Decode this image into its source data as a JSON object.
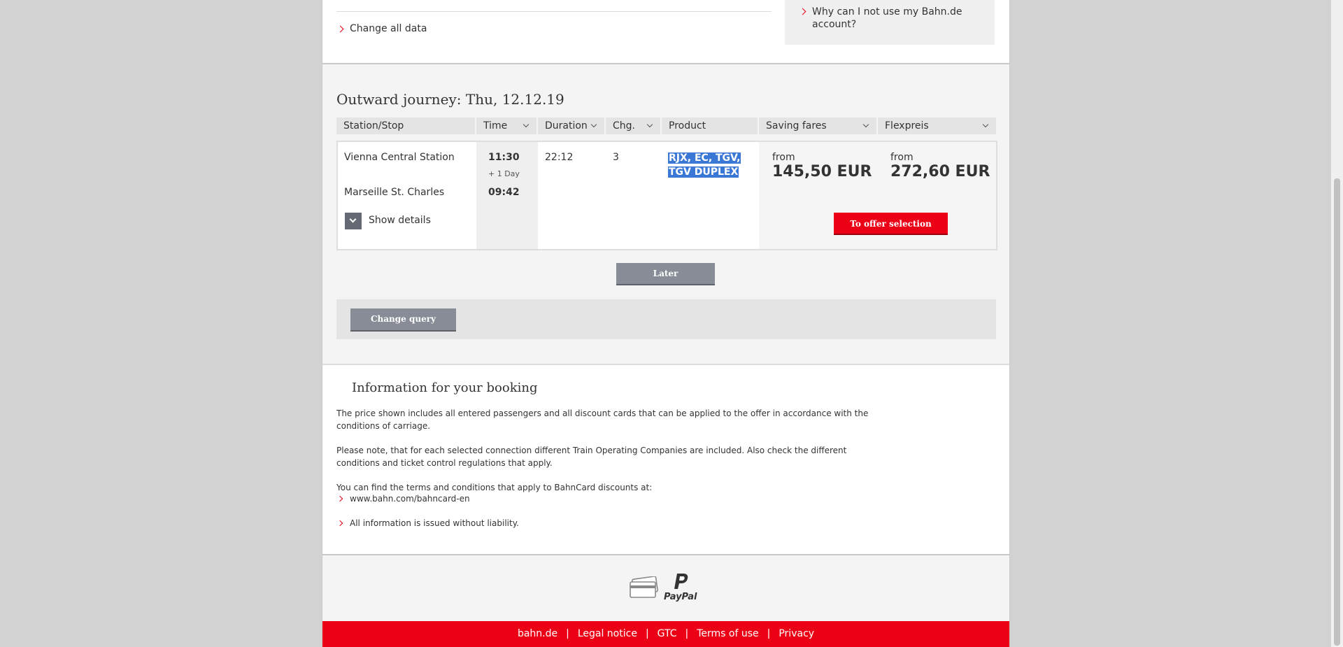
{
  "top": {
    "change_all_data": "Change all data",
    "why_link": "Why can I not use my Bahn.de account?"
  },
  "journey": {
    "heading": "Outward journey: Thu, 12.12.19",
    "columns": {
      "station": "Station/Stop",
      "time": "Time",
      "duration": "Duration",
      "changes": "Chg.",
      "product": "Product",
      "saving": "Saving fares",
      "flex": "Flexpreis"
    },
    "connection": {
      "from_station": "Vienna Central Station",
      "to_station": "Marseille St. Charles",
      "dep_time": "11:30",
      "day_offset": "+ 1 Day",
      "arr_time": "09:42",
      "duration": "22:12",
      "changes": "3",
      "product_line1": "RJX, EC, TGV,",
      "product_line2": "TGV DUPLEX",
      "saving_from": "from",
      "saving_price": "145,50 EUR",
      "flex_from": "from",
      "flex_price": "272,60 EUR",
      "show_details": "Show details",
      "offer_button": "To offer selection"
    },
    "later_button": "Later",
    "change_query_button": "Change query"
  },
  "booking": {
    "title": "Information for your booking",
    "p1": "The price shown includes all entered passengers and all discount cards that can be applied to the offer in accordance with the conditions of carriage.",
    "p2": "Please note, that for each selected connection different Train Operating Companies are included. Also check the different conditions and ticket control regulations that apply.",
    "p3": "You can find the terms and conditions that apply to BahnCard discounts at:",
    "link1": "www.bahn.com/bahncard-en",
    "link2": "All information is issued without liability."
  },
  "payment": {
    "card_icon": "credit-card-icon",
    "paypal_label": "PayPal"
  },
  "footer": {
    "bahn": "bahn.de",
    "legal": "Legal notice",
    "gtc": "GTC",
    "terms": "Terms of use",
    "privacy": "Privacy",
    "sep": "|"
  },
  "colors": {
    "brand_red": "#ec0016",
    "button_grey": "#878c96",
    "selection_blue": "#3b78d6"
  }
}
